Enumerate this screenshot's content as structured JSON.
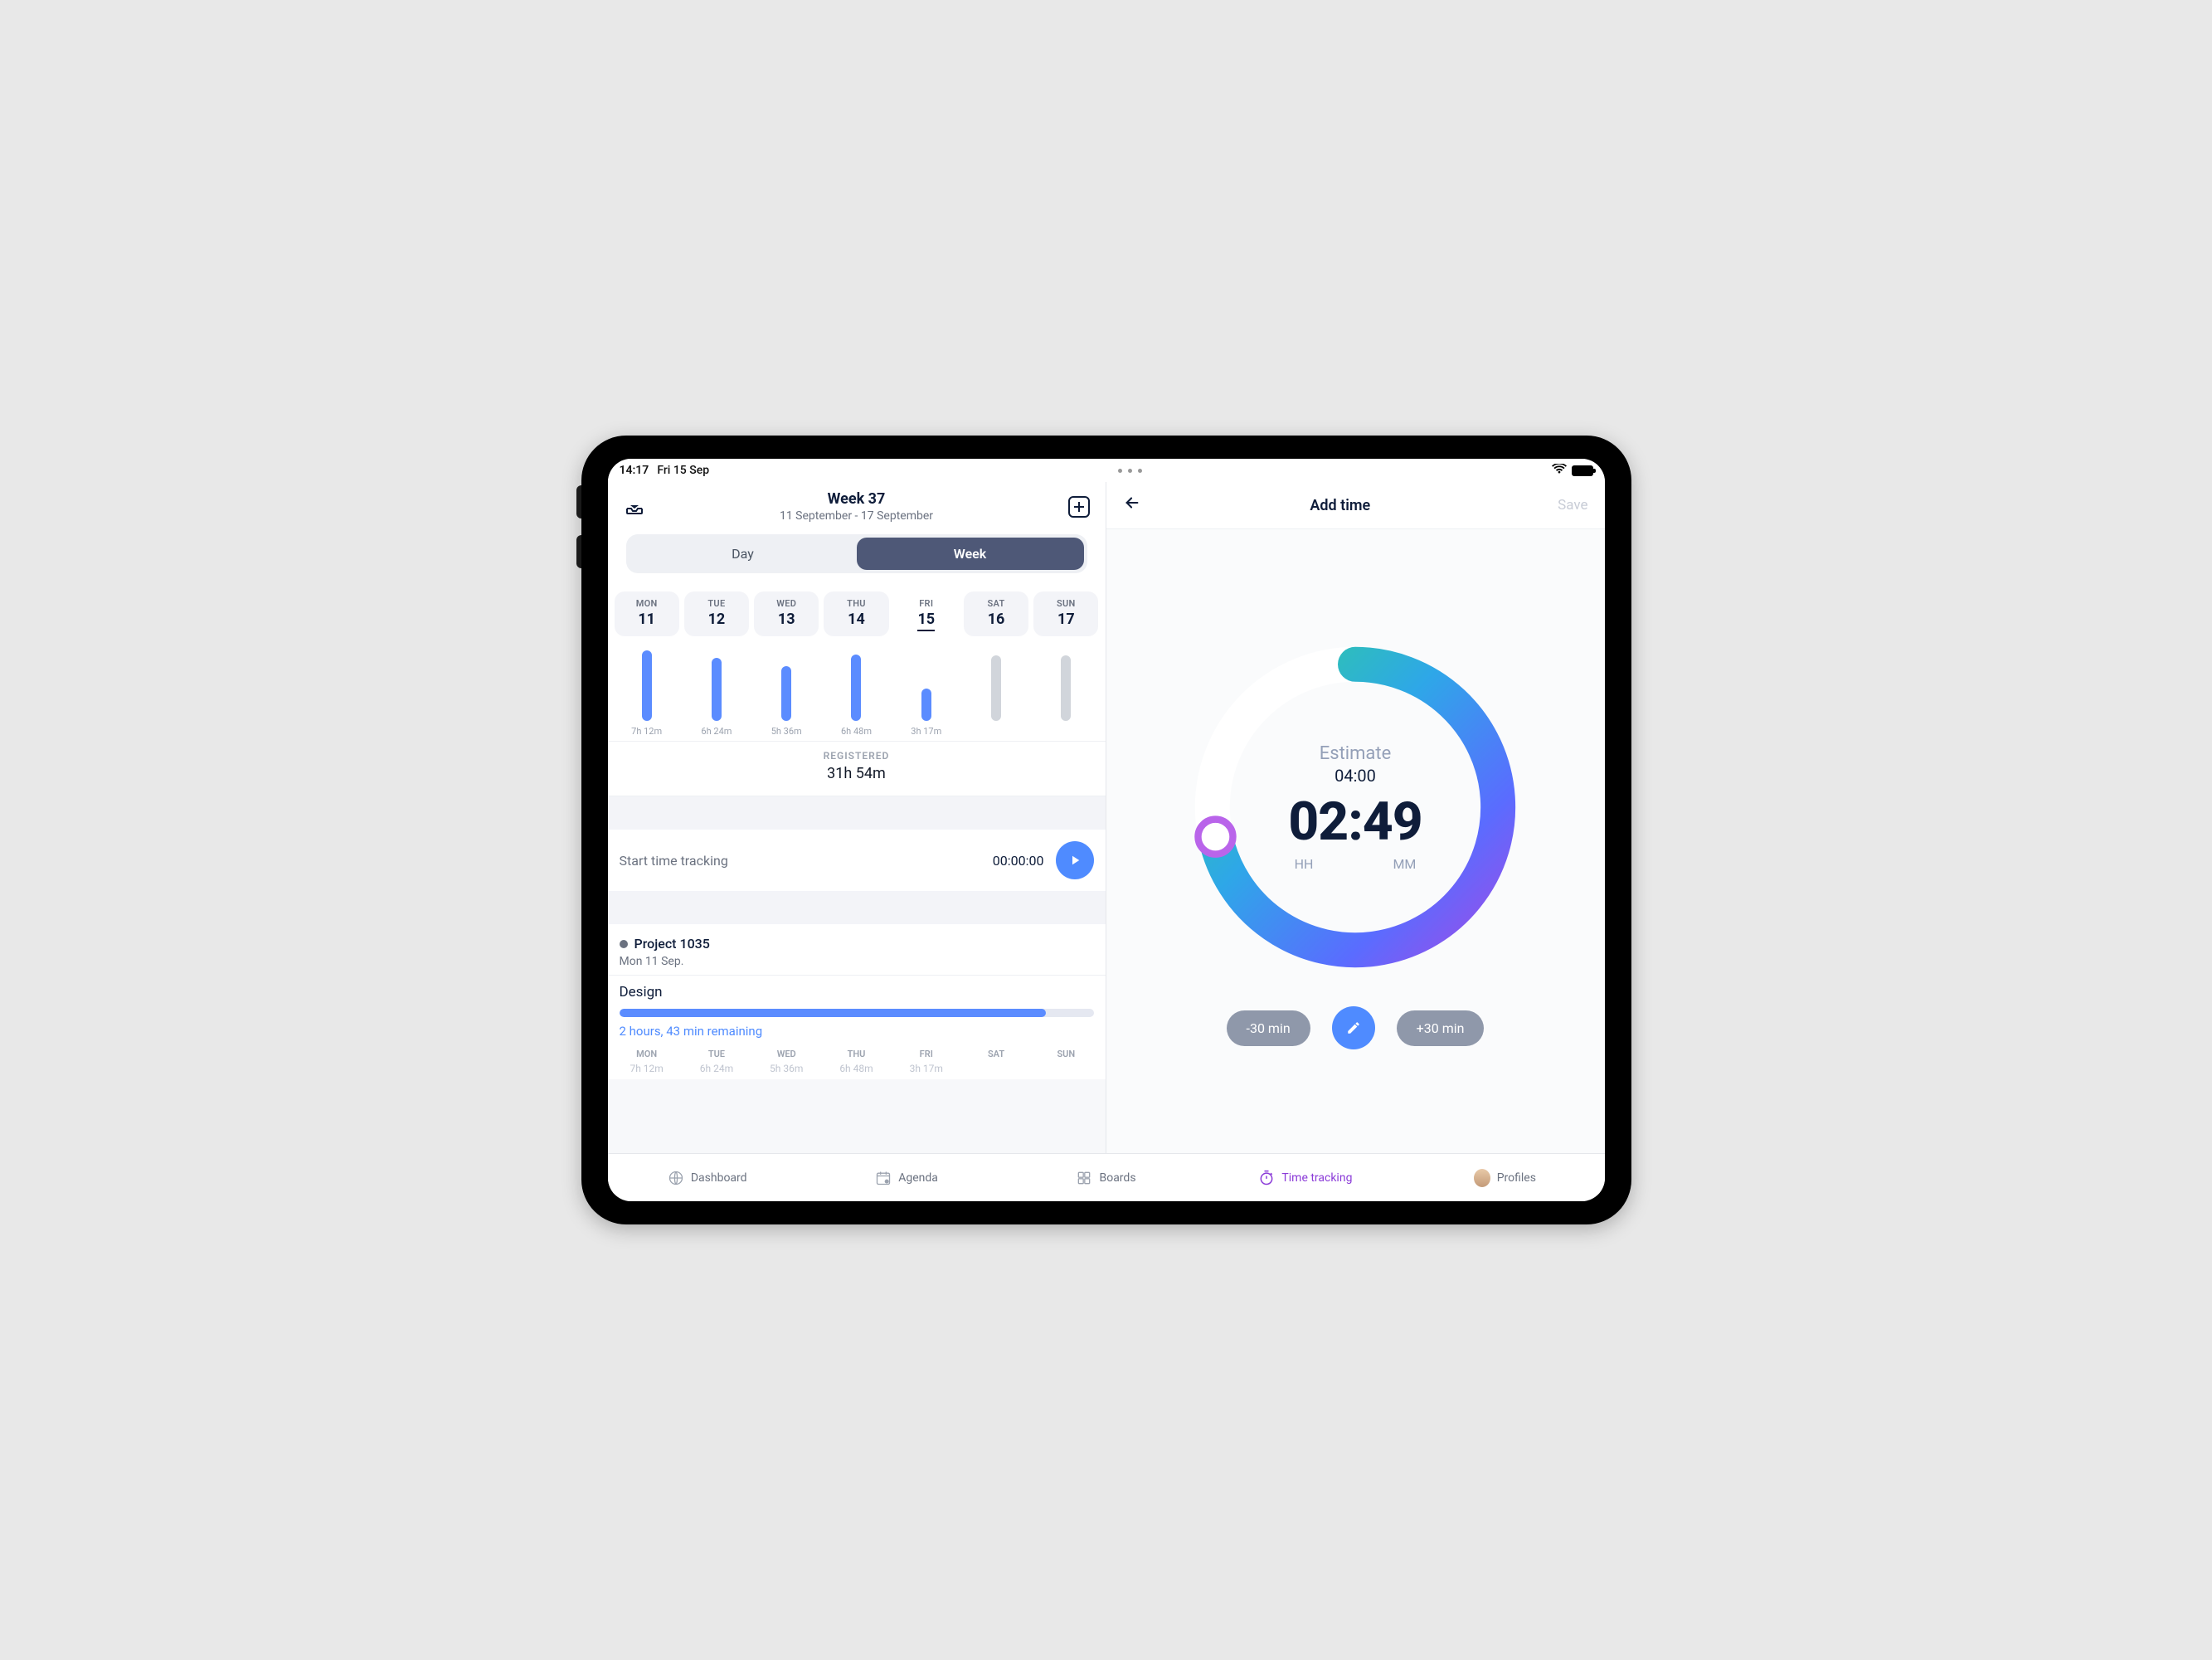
{
  "status": {
    "time": "14:17",
    "date": "Fri 15 Sep"
  },
  "left": {
    "week_label": "Week 37",
    "range": "11 September - 17 September",
    "seg_day": "Day",
    "seg_week": "Week",
    "days": [
      {
        "dw": "MON",
        "dn": "11",
        "selected": false,
        "bar_pct": 95,
        "fill": true,
        "dur": "7h 12m"
      },
      {
        "dw": "TUE",
        "dn": "12",
        "selected": false,
        "bar_pct": 84,
        "fill": true,
        "dur": "6h 24m"
      },
      {
        "dw": "WED",
        "dn": "13",
        "selected": false,
        "bar_pct": 73,
        "fill": true,
        "dur": "5h 36m"
      },
      {
        "dw": "THU",
        "dn": "14",
        "selected": false,
        "bar_pct": 89,
        "fill": true,
        "dur": "6h 48m"
      },
      {
        "dw": "FRI",
        "dn": "15",
        "selected": true,
        "bar_pct": 43,
        "fill": true,
        "dur": "3h 17m"
      },
      {
        "dw": "SAT",
        "dn": "16",
        "selected": false,
        "bar_pct": 88,
        "fill": false,
        "dur": ""
      },
      {
        "dw": "SUN",
        "dn": "17",
        "selected": false,
        "bar_pct": 88,
        "fill": false,
        "dur": ""
      }
    ],
    "registered_label": "REGISTERED",
    "registered_value": "31h 54m",
    "start_label": "Start time tracking",
    "start_value": "00:00:00",
    "project": {
      "name": "Project 1035",
      "date": "Mon 11 Sep."
    },
    "task": {
      "name": "Design",
      "progress_pct": 90,
      "remaining": "2 hours, 43 min remaining"
    },
    "mini_days": [
      "MON",
      "TUE",
      "WED",
      "THU",
      "FRI",
      "SAT",
      "SUN"
    ],
    "mini_vals": [
      "7h 12m",
      "6h 24m",
      "5h 36m",
      "6h 48m",
      "3h 17m",
      "",
      ""
    ]
  },
  "right": {
    "title": "Add time",
    "save": "Save",
    "estimate_label": "Estimate",
    "estimate_value": "04:00",
    "big": "02:49",
    "hh": "HH",
    "mm": "MM",
    "minus": "-30 min",
    "plus": "+30 min"
  },
  "tabs": {
    "dashboard": "Dashboard",
    "agenda": "Agenda",
    "boards": "Boards",
    "timetracking": "Time tracking",
    "profiles": "Profiles"
  }
}
